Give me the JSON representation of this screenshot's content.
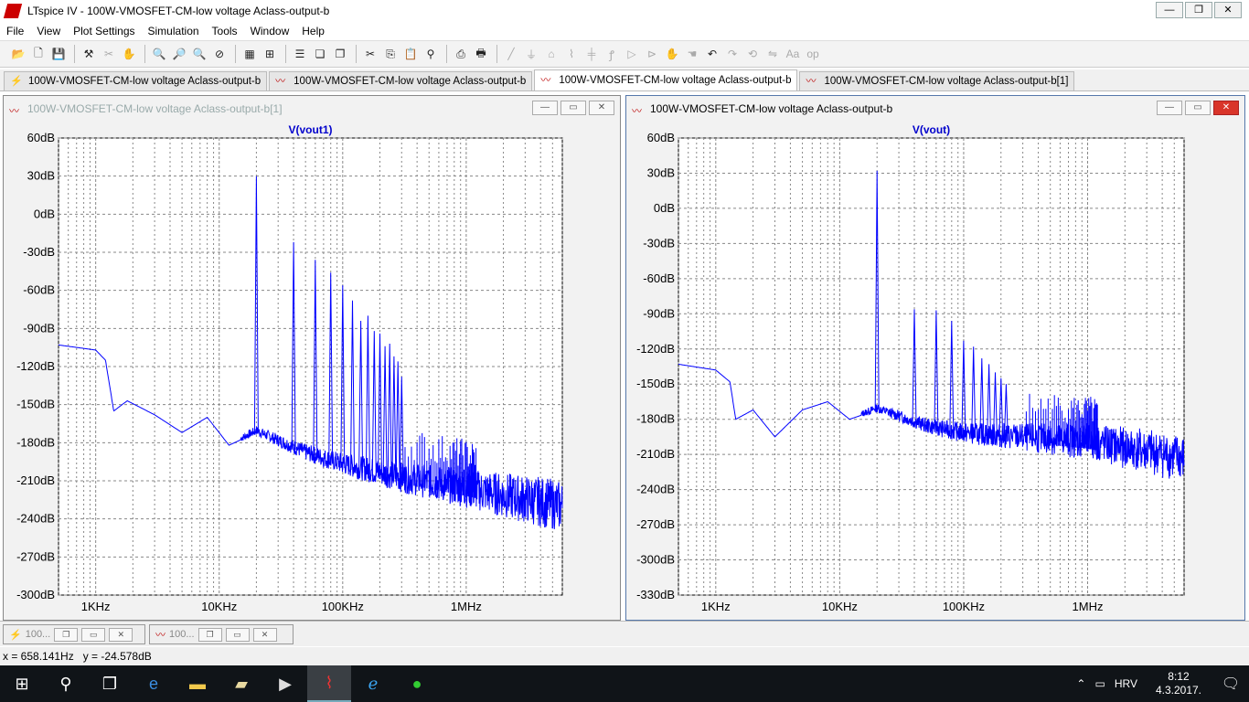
{
  "window": {
    "title": "LTspice IV - 100W-VMOSFET-CM-low voltage Aclass-output-b"
  },
  "menu": [
    "File",
    "View",
    "Plot Settings",
    "Simulation",
    "Tools",
    "Window",
    "Help"
  ],
  "toolbar_icons": [
    "open-icon",
    "new-icon",
    "save-icon",
    "hammer-icon",
    "wire-icon",
    "pan-icon",
    "zoom-in-icon",
    "zoom-area-icon",
    "zoom-out-icon",
    "zoom-cancel-icon",
    "autorange-icon",
    "fit-icon",
    "tile-h-icon",
    "cascade-icon",
    "tile-v-icon",
    "cut-icon",
    "copy-icon",
    "paste-icon",
    "find-icon",
    "print-preview-icon",
    "print-icon",
    "wire-draw-icon",
    "ground-icon",
    "label-icon",
    "resistor-icon",
    "capacitor-icon",
    "inductor-icon",
    "diode-icon",
    "component-icon",
    "move-icon",
    "drag-icon",
    "undo-icon",
    "redo-icon",
    "rotate-icon",
    "mirror-icon",
    "text-icon",
    "spice-icon"
  ],
  "tabs": [
    {
      "label": "100W-VMOSFET-CM-low voltage Aclass-output-b",
      "icon": "schematic-icon"
    },
    {
      "label": "100W-VMOSFET-CM-low voltage Aclass-output-b",
      "icon": "waveform-icon"
    },
    {
      "label": "100W-VMOSFET-CM-low voltage Aclass-output-b",
      "icon": "waveform-icon"
    },
    {
      "label": "100W-VMOSFET-CM-low voltage Aclass-output-b[1]",
      "icon": "waveform-icon"
    }
  ],
  "left_plot": {
    "title": "100W-VMOSFET-CM-low voltage Aclass-output-b[1]",
    "chart_data": {
      "type": "line",
      "title": "V(vout1)",
      "xscale": "log",
      "xlim": [
        500,
        6000000
      ],
      "ylim": [
        -300,
        60
      ],
      "yticks": [
        "60dB",
        "30dB",
        "0dB",
        "-30dB",
        "-60dB",
        "-90dB",
        "-120dB",
        "-150dB",
        "-180dB",
        "-210dB",
        "-240dB",
        "-270dB",
        "-300dB"
      ],
      "ytick_values": [
        60,
        30,
        0,
        -30,
        -60,
        -90,
        -120,
        -150,
        -180,
        -210,
        -240,
        -270,
        -300
      ],
      "xticks": [
        "1KHz",
        "10KHz",
        "100KHz",
        "1MHz"
      ],
      "xtick_values": [
        1000,
        10000,
        100000,
        1000000
      ],
      "series": [
        {
          "name": "V(vout1)",
          "color": "#0000ff",
          "baseline": [
            [
              500,
              -103
            ],
            [
              1000,
              -107
            ],
            [
              1200,
              -115
            ],
            [
              1400,
              -155
            ],
            [
              1800,
              -147
            ],
            [
              3000,
              -158
            ],
            [
              5000,
              -172
            ],
            [
              8000,
              -160
            ],
            [
              12000,
              -182
            ],
            [
              20000,
              -172
            ],
            [
              50000,
              -190
            ],
            [
              100000,
              -200
            ],
            [
              300000,
              -212
            ],
            [
              1000000,
              -222
            ],
            [
              3000000,
              -232
            ],
            [
              6000000,
              -238
            ]
          ],
          "peaks": [
            [
              20000,
              30
            ],
            [
              40000,
              -22
            ],
            [
              60000,
              -36
            ],
            [
              80000,
              -46
            ],
            [
              100000,
              -56
            ],
            [
              120000,
              -68
            ],
            [
              140000,
              -84
            ],
            [
              160000,
              -80
            ],
            [
              180000,
              -92
            ],
            [
              200000,
              -94
            ],
            [
              220000,
              -104
            ],
            [
              240000,
              -102
            ],
            [
              260000,
              -112
            ],
            [
              280000,
              -116
            ],
            [
              300000,
              -128
            ]
          ]
        }
      ]
    }
  },
  "right_plot": {
    "title": "100W-VMOSFET-CM-low voltage Aclass-output-b",
    "chart_data": {
      "type": "line",
      "title": "V(vout)",
      "xscale": "log",
      "xlim": [
        500,
        6000000
      ],
      "ylim": [
        -330,
        60
      ],
      "yticks": [
        "60dB",
        "30dB",
        "0dB",
        "-30dB",
        "-60dB",
        "-90dB",
        "-120dB",
        "-150dB",
        "-180dB",
        "-210dB",
        "-240dB",
        "-270dB",
        "-300dB",
        "-330dB"
      ],
      "ytick_values": [
        60,
        30,
        0,
        -30,
        -60,
        -90,
        -120,
        -150,
        -180,
        -210,
        -240,
        -270,
        -300,
        -330
      ],
      "xticks": [
        "1KHz",
        "10KHz",
        "100KHz",
        "1MHz"
      ],
      "xtick_values": [
        1000,
        10000,
        100000,
        1000000
      ],
      "series": [
        {
          "name": "V(vout)",
          "color": "#0000ff",
          "baseline": [
            [
              500,
              -133
            ],
            [
              1000,
              -138
            ],
            [
              1300,
              -148
            ],
            [
              1450,
              -180
            ],
            [
              2000,
              -172
            ],
            [
              3000,
              -195
            ],
            [
              5000,
              -172
            ],
            [
              8000,
              -165
            ],
            [
              12000,
              -180
            ],
            [
              20000,
              -172
            ],
            [
              50000,
              -188
            ],
            [
              100000,
              -195
            ],
            [
              300000,
              -200
            ],
            [
              1000000,
              -205
            ],
            [
              3000000,
              -215
            ],
            [
              6000000,
              -222
            ]
          ],
          "peaks": [
            [
              20000,
              32
            ],
            [
              40000,
              -86
            ],
            [
              60000,
              -87
            ],
            [
              80000,
              -96
            ],
            [
              100000,
              -113
            ],
            [
              120000,
              -118
            ],
            [
              140000,
              -128
            ],
            [
              160000,
              -133
            ],
            [
              180000,
              -140
            ],
            [
              200000,
              -145
            ],
            [
              220000,
              -150
            ]
          ]
        }
      ]
    }
  },
  "minimized": [
    {
      "label": "100...",
      "icon": "schematic-icon"
    },
    {
      "label": "100...",
      "icon": "waveform-icon"
    }
  ],
  "status": {
    "cursor": "x = 658.141Hz   y = -24.578dB"
  },
  "taskbar": {
    "lang": "HRV",
    "time": "8:12",
    "date": "4.3.2017.",
    "icons": [
      "windows-start-icon",
      "search-icon",
      "task-view-icon",
      "edge-icon",
      "file-explorer-icon",
      "folder-icon",
      "media-icon",
      "ltspice-icon",
      "ie-icon",
      "app-icon"
    ]
  }
}
